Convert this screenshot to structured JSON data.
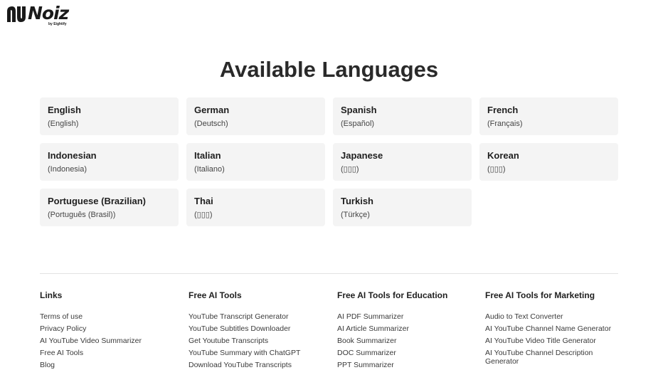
{
  "brand": {
    "name": "Noiz",
    "tagline": "by Eightify"
  },
  "page_title": "Available Languages",
  "languages": [
    {
      "name": "English",
      "native": "(English)"
    },
    {
      "name": "German",
      "native": "(Deutsch)"
    },
    {
      "name": "Spanish",
      "native": "(Español)"
    },
    {
      "name": "French",
      "native": "(Français)"
    },
    {
      "name": "Indonesian",
      "native": "(Indonesia)"
    },
    {
      "name": "Italian",
      "native": "(Italiano)"
    },
    {
      "name": "Japanese",
      "native": "(▯▯▯)"
    },
    {
      "name": "Korean",
      "native": "(▯▯▯)"
    },
    {
      "name": "Portuguese (Brazilian)",
      "native": "(Português (Brasil))"
    },
    {
      "name": "Thai",
      "native": "(▯▯▯)"
    },
    {
      "name": "Turkish",
      "native": "(Türkçe)"
    }
  ],
  "footer": {
    "columns": [
      {
        "heading": "Links",
        "links": [
          "Terms of use",
          "Privacy Policy",
          "AI YouTube Video Summarizer",
          "Free AI Tools",
          "Blog"
        ]
      },
      {
        "heading": "Free AI Tools",
        "links": [
          "YouTube Transcript Generator",
          "YouTube Subtitles Downloader",
          "Get Youtube Transcripts",
          "YouTube Summary with ChatGPT",
          "Download YouTube Transcripts"
        ]
      },
      {
        "heading": "Free AI Tools for Education",
        "links": [
          "AI PDF Summarizer",
          "AI Article Summarizer",
          "Book Summarizer",
          "DOC Summarizer",
          "PPT Summarizer"
        ]
      },
      {
        "heading": "Free AI Tools for Marketing",
        "links": [
          "Audio to Text Converter",
          "AI YouTube Channel Name Generator",
          "AI YouTube Video Title Generator",
          "AI YouTube Channel Description Generator"
        ]
      }
    ]
  }
}
